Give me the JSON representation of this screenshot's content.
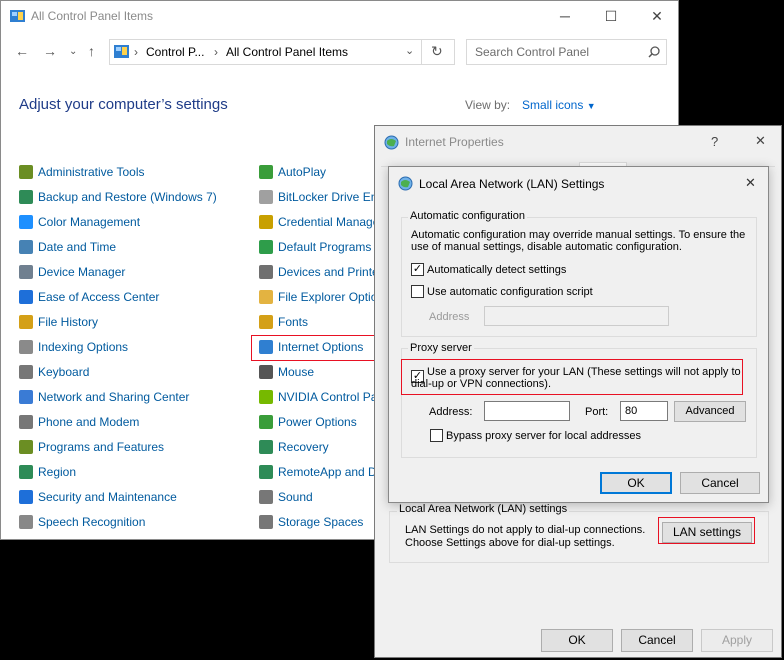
{
  "control_panel": {
    "title": "All Control Panel Items",
    "window_controls": {
      "minimize": "─",
      "maximize": "☐",
      "close": "✕"
    },
    "breadcrumb": [
      "Control P...",
      "All Control Panel Items"
    ],
    "search_placeholder": "Search Control Panel",
    "heading": "Adjust your computer’s settings",
    "view_by_label": "View by:",
    "view_by_value": "Small icons",
    "left_items": [
      {
        "label": "Administrative Tools",
        "color": "#6b8e23"
      },
      {
        "label": "Backup and Restore (Windows 7)",
        "color": "#2e8b57"
      },
      {
        "label": "Color Management",
        "color": "#1e90ff"
      },
      {
        "label": "Date and Time",
        "color": "#4682b4"
      },
      {
        "label": "Device Manager",
        "color": "#708090"
      },
      {
        "label": "Ease of Access Center",
        "color": "#1e6fd9"
      },
      {
        "label": "File History",
        "color": "#d4a017"
      },
      {
        "label": "Indexing Options",
        "color": "#8a8a8a"
      },
      {
        "label": "Keyboard",
        "color": "#777777"
      },
      {
        "label": "Network and Sharing Center",
        "color": "#3a7bd5"
      },
      {
        "label": "Phone and Modem",
        "color": "#777777"
      },
      {
        "label": "Programs and Features",
        "color": "#6b8e23"
      },
      {
        "label": "Region",
        "color": "#2e8b57"
      },
      {
        "label": "Security and Maintenance",
        "color": "#1e6fd9"
      },
      {
        "label": "Speech Recognition",
        "color": "#888888"
      }
    ],
    "right_items": [
      {
        "label": "AutoPlay",
        "color": "#3a9d3a"
      },
      {
        "label": "BitLocker Drive Enc",
        "color": "#a0a0a0"
      },
      {
        "label": "Credential Manage",
        "color": "#c8a000"
      },
      {
        "label": "Default Programs",
        "color": "#2e9d4a"
      },
      {
        "label": "Devices and Printe",
        "color": "#707070"
      },
      {
        "label": "File Explorer Optio",
        "color": "#e3b341"
      },
      {
        "label": "Fonts",
        "color": "#d4a017"
      },
      {
        "label": "Internet Options",
        "color": "#2f7fd1"
      },
      {
        "label": "Mouse",
        "color": "#555555"
      },
      {
        "label": "NVIDIA Control Pa",
        "color": "#76b900"
      },
      {
        "label": "Power Options",
        "color": "#3a9d3a"
      },
      {
        "label": "Recovery",
        "color": "#2e8b57"
      },
      {
        "label": "RemoteApp and D",
        "color": "#2e8b57"
      },
      {
        "label": "Sound",
        "color": "#777777"
      },
      {
        "label": "Storage Spaces",
        "color": "#777777"
      }
    ]
  },
  "internet_properties": {
    "title": "Internet Properties",
    "help": "?",
    "close": "✕",
    "lan_group_label": "Local Area Network (LAN) settings",
    "lan_text_1": "LAN Settings do not apply to dial-up connections.",
    "lan_text_2": "Choose Settings above for dial-up settings.",
    "lan_settings_button": "LAN settings",
    "ok": "OK",
    "cancel": "Cancel",
    "apply": "Apply"
  },
  "lan_dialog": {
    "title": "Local Area Network (LAN) Settings",
    "close": "✕",
    "auto_group_label": "Automatic configuration",
    "auto_text_1": "Automatic configuration may override manual settings.  To ensure the",
    "auto_text_2": "use of manual settings, disable automatic configuration.",
    "auto_detect_label": "Automatically detect settings",
    "auto_detect_checked": "✓",
    "auto_script_label": "Use automatic configuration script",
    "address_label": "Address",
    "proxy_group_label": "Proxy server",
    "proxy_label_1": "Use a proxy server for your LAN (These settings will not apply to",
    "proxy_label_2": "dial-up or VPN connections).",
    "proxy_checked": "✓",
    "proxy_address_label": "Address:",
    "port_label": "Port:",
    "port_value": "80",
    "advanced_button": "Advanced",
    "bypass_label": "Bypass proxy server for local addresses",
    "ok": "OK",
    "cancel": "Cancel"
  },
  "colors": {
    "highlight_red": "#e81123",
    "link_blue": "#005a9e",
    "focus_blue": "#0078d7"
  }
}
